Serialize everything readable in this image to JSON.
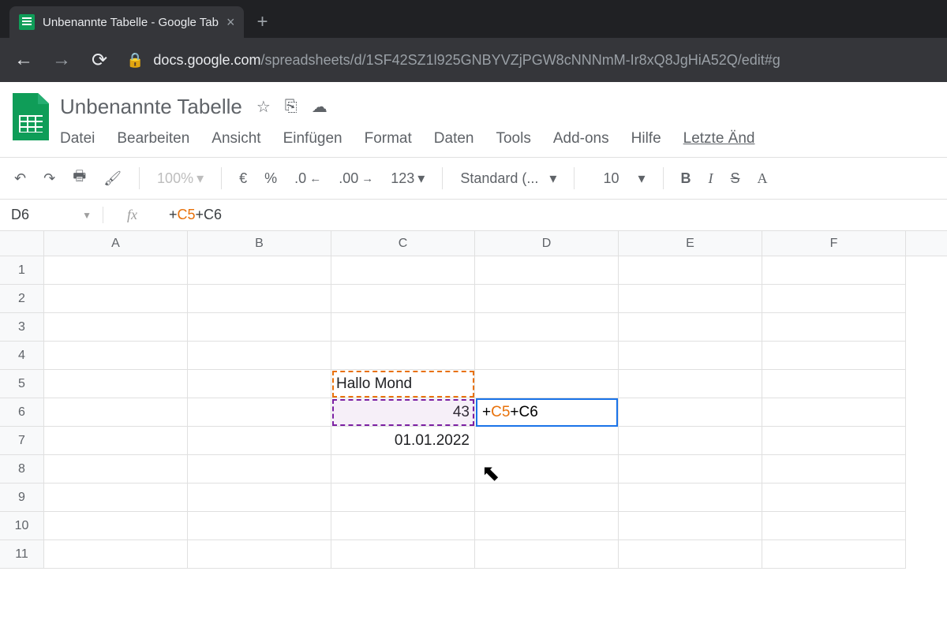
{
  "browser": {
    "tab_title": "Unbenannte Tabelle - Google Tab",
    "url_domain": "docs.google.com",
    "url_path": "/spreadsheets/d/1SF42SZ1l925GNBYVZjPGW8cNNNmM-Ir8xQ8JgHiA52Q/edit#g"
  },
  "doc": {
    "title": "Unbenannte Tabelle"
  },
  "menubar": {
    "file": "Datei",
    "edit": "Bearbeiten",
    "view": "Ansicht",
    "insert": "Einfügen",
    "format": "Format",
    "data": "Daten",
    "tools": "Tools",
    "addons": "Add-ons",
    "help": "Hilfe",
    "last": "Letzte Änd"
  },
  "toolbar": {
    "zoom": "100%",
    "currency": "€",
    "percent": "%",
    "dec_dec": ".0",
    "dec_inc": ".00",
    "num_format": "123",
    "font": "Standard (...",
    "font_size": "10",
    "bold": "B",
    "italic": "I",
    "strike": "S",
    "textcolor": "A"
  },
  "formula_bar": {
    "name_box": "D6",
    "fx": "fx",
    "prefix": "+",
    "ref1": "C5",
    "mid": "+C6"
  },
  "columns": [
    "A",
    "B",
    "C",
    "D",
    "E",
    "F"
  ],
  "rows": [
    "1",
    "2",
    "3",
    "4",
    "5",
    "6",
    "7",
    "8",
    "9",
    "10",
    "11"
  ],
  "cells": {
    "c5": "Hallo Mond",
    "c6": "43",
    "c7": "01.01.2022",
    "d6_prefix": "+",
    "d6_ref": "C5",
    "d6_rest": "+C6"
  }
}
